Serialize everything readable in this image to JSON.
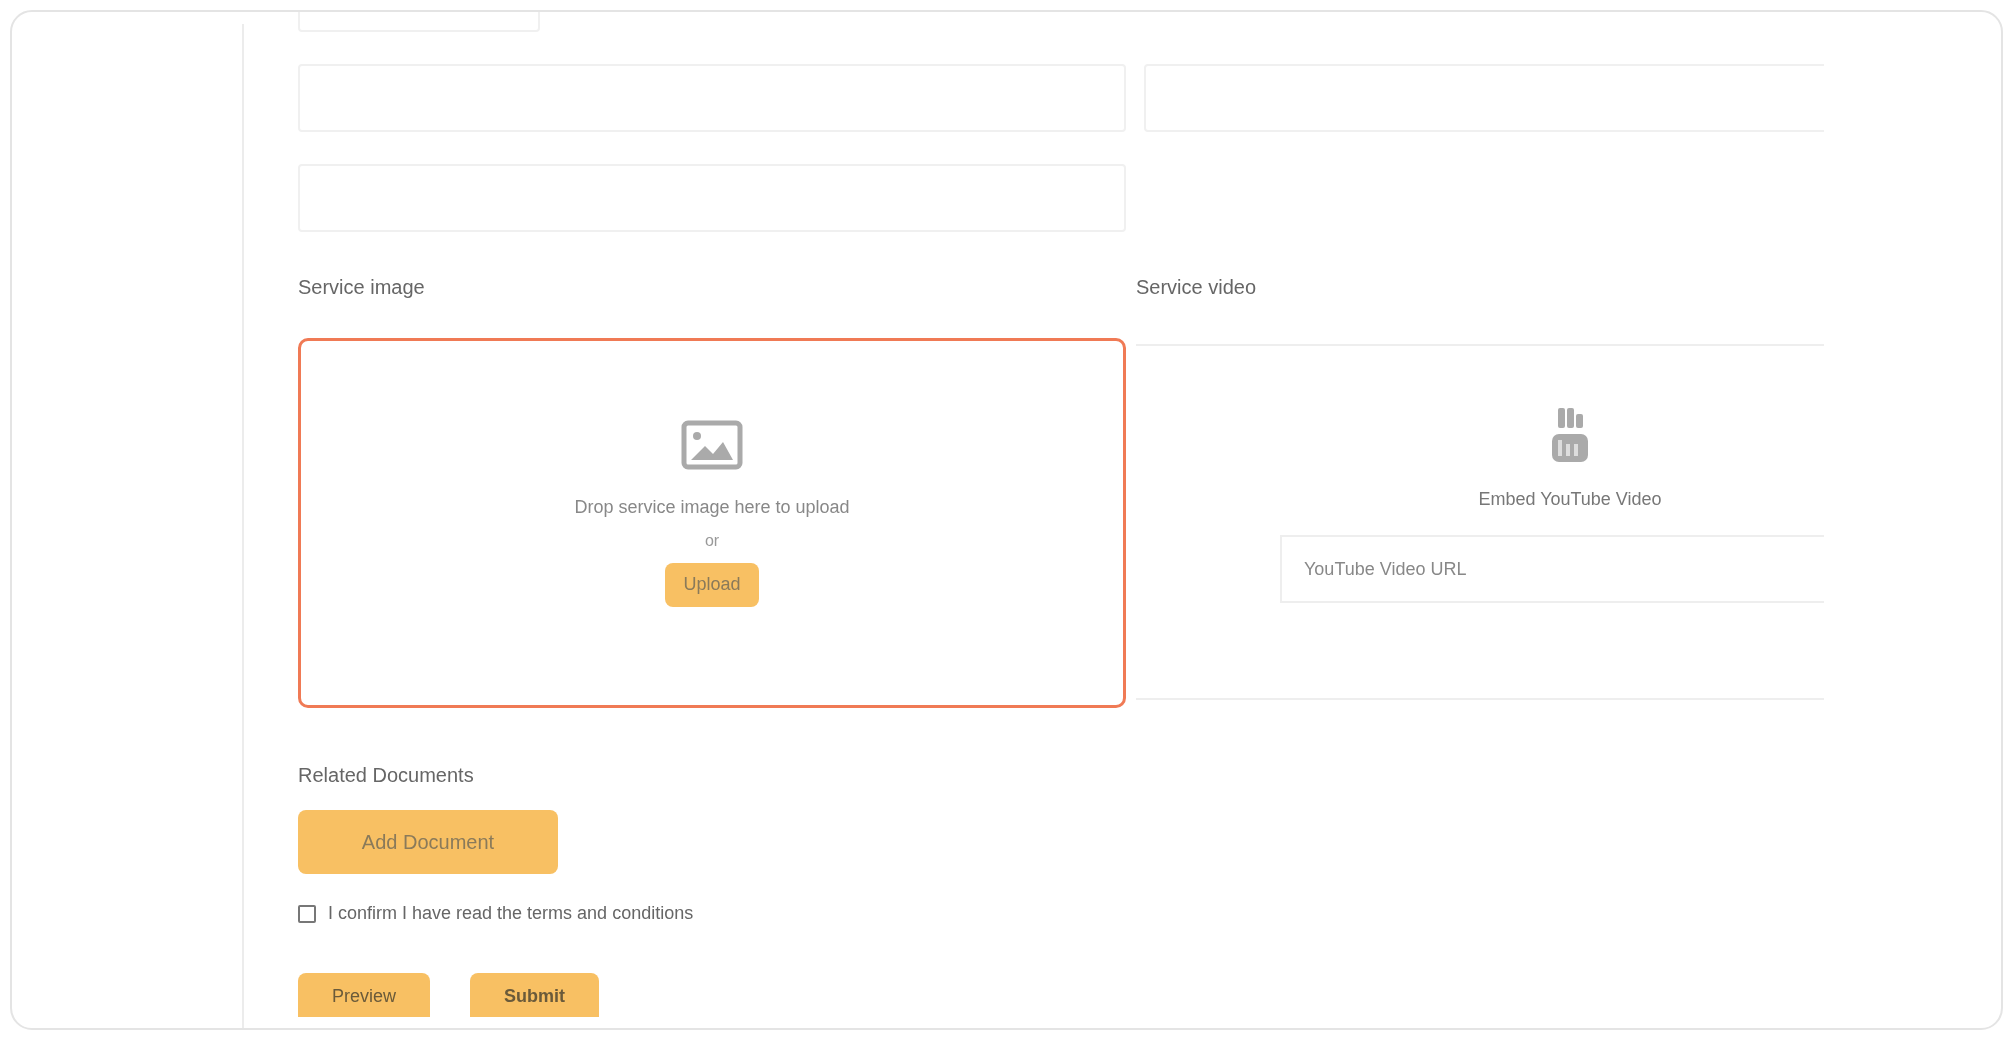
{
  "image_upload": {
    "label": "Service image",
    "hint": "Drop service image here to upload",
    "or": "or",
    "button": "Upload",
    "focused": true
  },
  "video": {
    "label": "Service video",
    "title": "Embed YouTube Video",
    "url_placeholder": "YouTube Video URL"
  },
  "documents": {
    "label": "Related Documents",
    "button": "Add Document"
  },
  "terms": {
    "label": "I confirm I have read the terms and conditions",
    "checked": false
  },
  "actions": [
    {
      "label": "Preview",
      "bold": false
    },
    {
      "label": "Submit",
      "bold": true
    }
  ]
}
